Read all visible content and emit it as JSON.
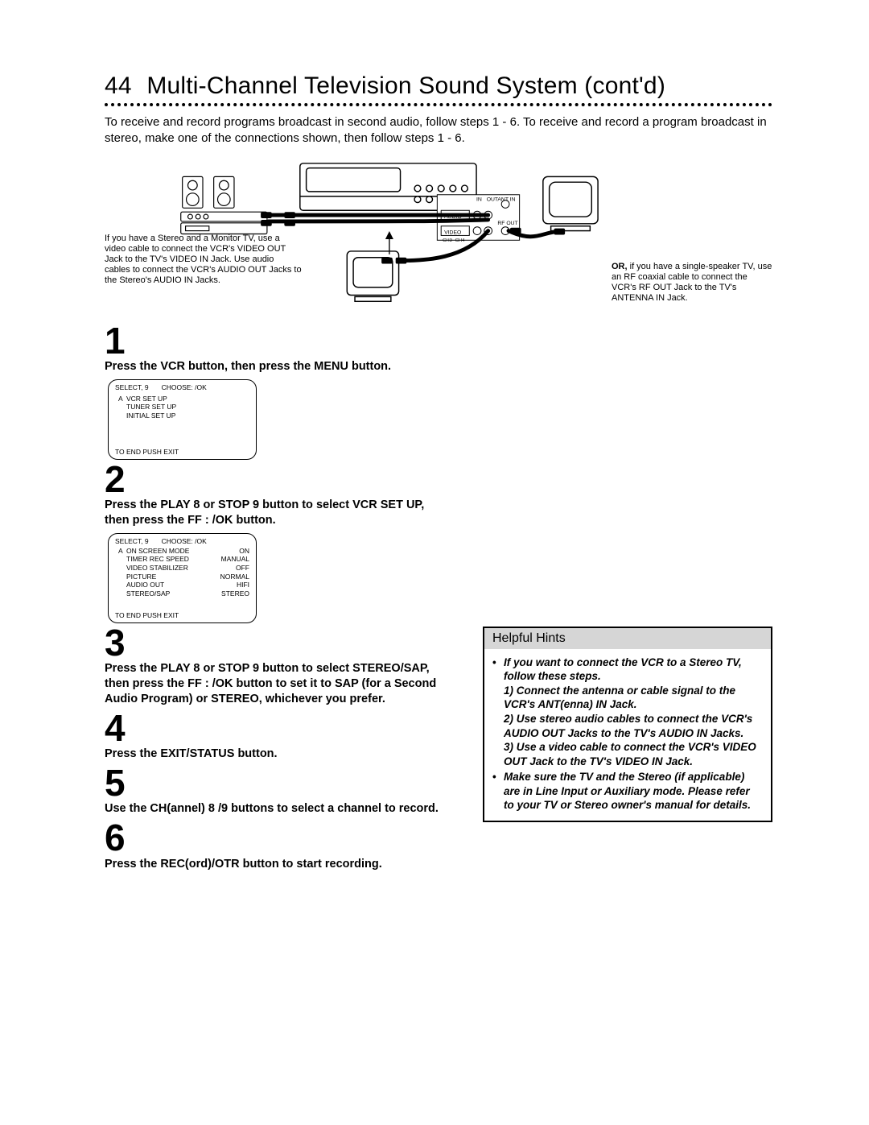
{
  "header": {
    "page_number": "44",
    "title": "Multi-Channel Television Sound System (cont'd)"
  },
  "intro": "To receive and record programs broadcast in second audio, follow steps 1 - 6. To receive and record a program broadcast in stereo, make one of the connections shown, then follow steps 1 - 6.",
  "diagram": {
    "labels": {
      "in": "IN",
      "out": "OUT",
      "ant_in": "ANT IN",
      "rf_out": "RF OUT",
      "audio": "AUDIO",
      "video": "VIDEO",
      "ch3": "CH3",
      "ch4": "CH4"
    },
    "caption_left": "If you have a Stereo and a Monitor TV, use a video cable to connect the VCR's VIDEO OUT Jack to the TV's VIDEO IN Jack. Use audio cables to connect the VCR's AUDIO OUT Jacks to the Stereo's AUDIO IN Jacks.",
    "caption_right_or": "OR,",
    "caption_right": " if you have a single-speaker TV, use an RF coaxial cable to connect the VCR's RF OUT Jack to the TV's ANTENNA IN Jack."
  },
  "steps": {
    "s1": {
      "num": "1",
      "text": "Press the VCR button, then press the MENU button."
    },
    "s2": {
      "num": "2",
      "text": "Press the PLAY 8 or STOP 9 button to select VCR SET UP, then press the FF : /OK button."
    },
    "s3": {
      "num": "3",
      "text": "Press the PLAY 8 or STOP 9 button to select STEREO/SAP, then press the FF : /OK button to set it to SAP (for a Second Audio Program) or STEREO, whichever you prefer."
    },
    "s4": {
      "num": "4",
      "text": "Press the EXIT/STATUS button."
    },
    "s5": {
      "num": "5",
      "text": "Use the CH(annel) 8 /9 buttons to select a channel to record."
    },
    "s6": {
      "num": "6",
      "text": "Press the REC(ord)/OTR button to start recording."
    }
  },
  "osd1": {
    "select": "SELECT,  9",
    "choose": "CHOOSE:  /OK",
    "rows": [
      {
        "marker": "A",
        "label": "VCR SET UP",
        "value": ""
      },
      {
        "marker": "",
        "label": "TUNER SET UP",
        "value": ""
      },
      {
        "marker": "",
        "label": "INITIAL SET UP",
        "value": ""
      }
    ],
    "foot": "TO END PUSH EXIT"
  },
  "osd2": {
    "select": "SELECT,  9",
    "choose": "CHOOSE:  /OK",
    "rows": [
      {
        "marker": "A",
        "label": "ON SCREEN MODE",
        "value": "ON"
      },
      {
        "marker": "",
        "label": "TIMER REC SPEED",
        "value": "MANUAL"
      },
      {
        "marker": "",
        "label": "VIDEO STABILIZER",
        "value": "OFF"
      },
      {
        "marker": "",
        "label": "PICTURE",
        "value": "NORMAL"
      },
      {
        "marker": "",
        "label": "AUDIO OUT",
        "value": "HIFI"
      },
      {
        "marker": "",
        "label": "STEREO/SAP",
        "value": "STEREO"
      }
    ],
    "foot": "TO END PUSH EXIT"
  },
  "hints": {
    "title": "Helpful Hints",
    "b1_lead": "If you want to connect the VCR to a Stereo TV, follow these steps.",
    "b1_1": "1) Connect the antenna or cable signal to the VCR's ANT(enna) IN Jack.",
    "b1_2": "2) Use stereo audio cables to connect the VCR's AUDIO OUT Jacks to the TV's AUDIO IN Jacks.",
    "b1_3": "3) Use a video cable to connect the VCR's VIDEO OUT Jack to the TV's VIDEO IN Jack.",
    "b2": "Make sure the TV and the Stereo (if applicable) are in Line Input or Auxiliary mode. Please refer to your TV or Stereo owner's manual for details."
  }
}
